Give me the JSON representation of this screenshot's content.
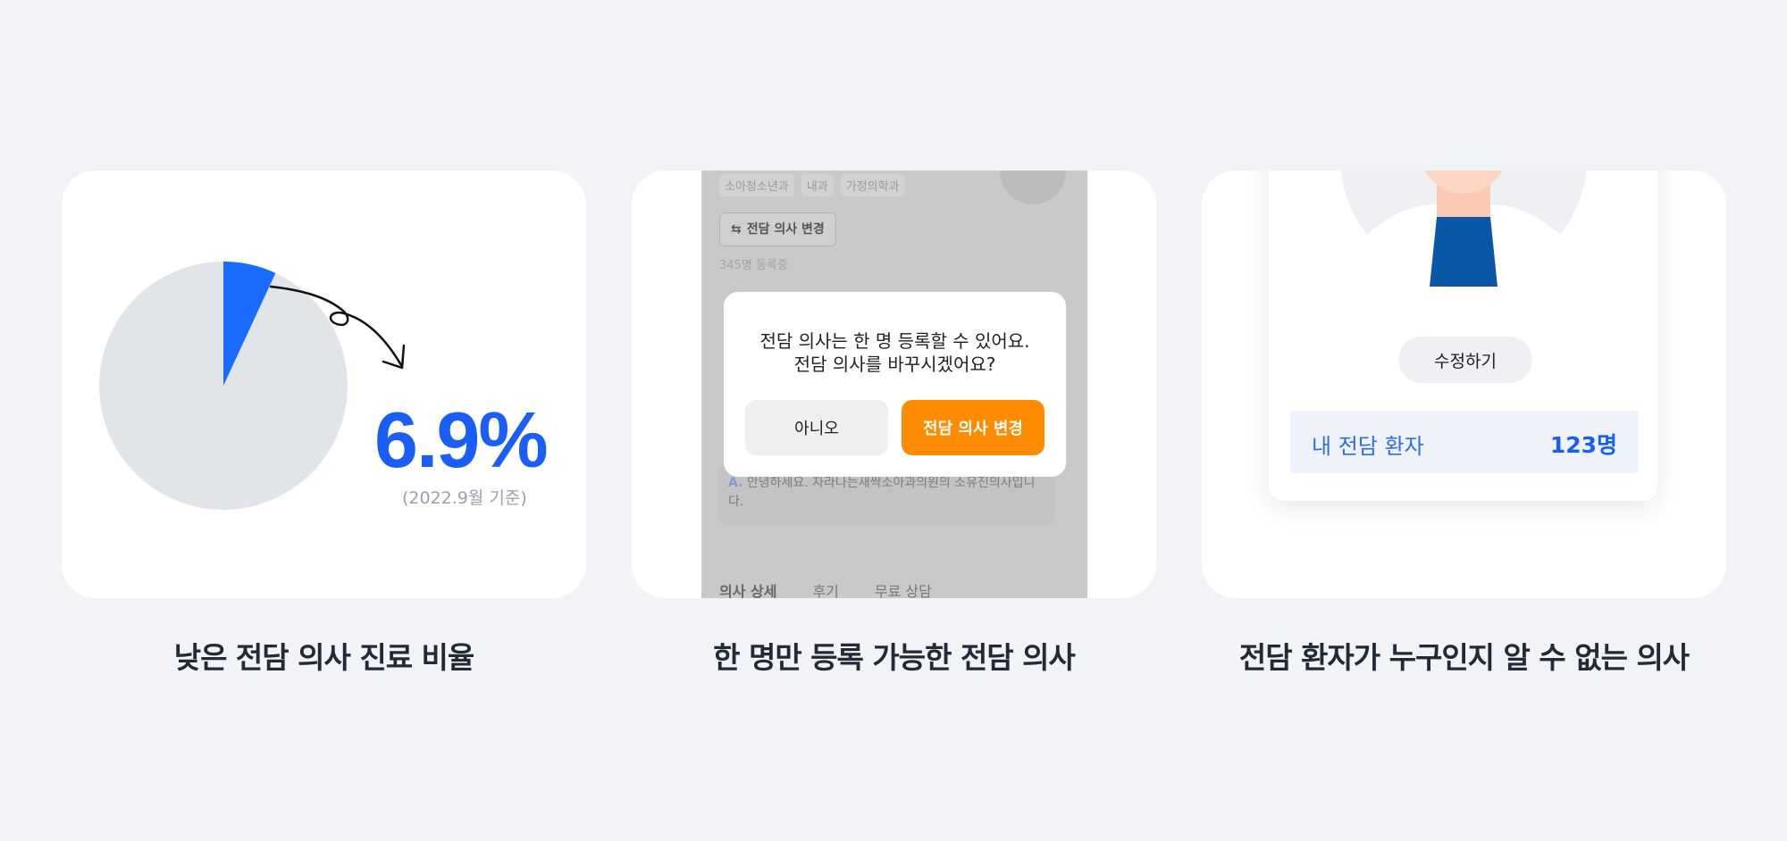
{
  "cards": {
    "ratio": {
      "caption": "낮은 전담 의사 진료 비율",
      "value_label": "6.9%",
      "note": "(2022.9월 기준)",
      "colors": {
        "highlight": "#1a6bff",
        "rest": "#e1e5ea"
      },
      "chart_data": {
        "type": "pie",
        "values": [
          6.9,
          93.1
        ],
        "highlighted_index": 0
      }
    },
    "single_doctor": {
      "caption": "한 명만 등록 가능한 전담 의사",
      "background": {
        "tags": [
          "소아청소년과",
          "내과",
          "가정의학과"
        ],
        "change_button": "전담 의사 변경",
        "registered_count": "345명 등록중",
        "answer_prefix": "A.",
        "answer_text": "안녕하세요. 자라나는새싹소아과의원의 소유진의사입니다.",
        "tabs": [
          "의사 상세",
          "후기",
          "무료 상담"
        ]
      },
      "dialog": {
        "line1": "전담 의사는 한 명 등록할 수 있어요.",
        "line2": "전담 의사를 바꾸시겠어요?",
        "no_label": "아니오",
        "yes_label": "전담 의사 변경",
        "accent_color": "#ff8c00"
      }
    },
    "unknown_patients": {
      "caption": "전담 환자가 누구인지 알 수 없는 의사",
      "edit_label": "수정하기",
      "patients_label": "내 전담 환자",
      "patients_count": "123명",
      "accent_color": "#1a5ef5"
    }
  }
}
